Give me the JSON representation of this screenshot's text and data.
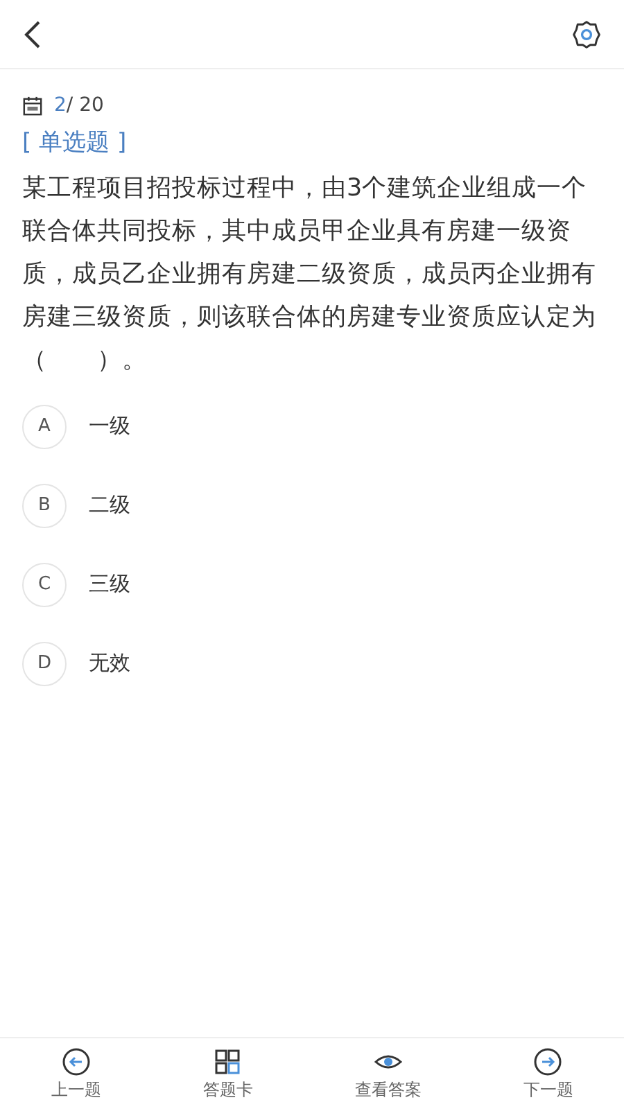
{
  "progress": {
    "current": "2",
    "total": "/ 20"
  },
  "question": {
    "type_label": "[ 单选题 ]",
    "text": "某工程项目招投标过程中，由3个建筑企业组成一个联合体共同投标，其中成员甲企业具有房建一级资质，成员乙企业拥有房建二级资质，成员丙企业拥有房建三级资质，则该联合体的房建专业资质应认定为（　　）。"
  },
  "options": [
    {
      "letter": "A",
      "text": "一级",
      "selected": false
    },
    {
      "letter": "B",
      "text": "二级",
      "selected": false
    },
    {
      "letter": "C",
      "text": "三级",
      "selected": false
    },
    {
      "letter": "D",
      "text": "无效",
      "selected": false
    }
  ],
  "bottom_bar": [
    {
      "kind": "prev",
      "label": "上一题"
    },
    {
      "kind": "card",
      "label": "答题卡"
    },
    {
      "kind": "answer",
      "label": "查看答案"
    },
    {
      "kind": "next",
      "label": "下一题"
    }
  ]
}
